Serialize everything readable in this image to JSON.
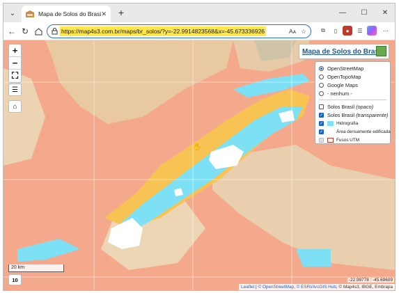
{
  "browser": {
    "tab_title": "Mapa de Solos do Brasil",
    "tab_close": "✕",
    "new_tab": "+",
    "url": "https://map4s3.com.br/maps/br_solos/?y=-22.9914823568&x=-45.673336926",
    "read_aloud": "Aᴀ",
    "window_controls": {
      "minimize": "—",
      "maximize": "☐",
      "close": "✕"
    }
  },
  "map": {
    "title": "Mapa de Solos do Brasil",
    "base_layers": [
      {
        "label": "OpenStreetMap",
        "selected": true
      },
      {
        "label": "OpenTopoMap",
        "selected": false
      },
      {
        "label": "Google Maps",
        "selected": false
      },
      {
        "label": "- nenhum -",
        "selected": false
      }
    ],
    "overlays": [
      {
        "label": "Solos Brasil",
        "suffix": "(opaco)",
        "checked": false
      },
      {
        "label": "Solos Brasil",
        "suffix": "(transparente)",
        "checked": true
      }
    ],
    "sub_layers": [
      {
        "label": "Hidrografia",
        "checked": true,
        "swatch": "#7ee0f5"
      },
      {
        "label": "Área densamente edificada",
        "checked": true,
        "swatch": "#ffffff"
      },
      {
        "label": "Fusos UTM",
        "checked": false,
        "swatch": "#ffffff"
      }
    ],
    "scale_label": "20 km",
    "zoom_level": "10",
    "coordinates": "-22.99778 : -45.69609",
    "attribution": {
      "leaflet": "Leaflet",
      "osm": "© OpenStreetMap",
      "esri": "© ESRI/ArcGIS Hub",
      "rest": ", © Map4s3, IBGE, Embrapa"
    },
    "colors": {
      "soil_orange": "#f4a98c",
      "soil_tan": "#e9c9a2",
      "soil_yellow": "#f7c453",
      "hydro_cyan": "#7ee0f5",
      "urban_white": "#ffffff"
    }
  }
}
